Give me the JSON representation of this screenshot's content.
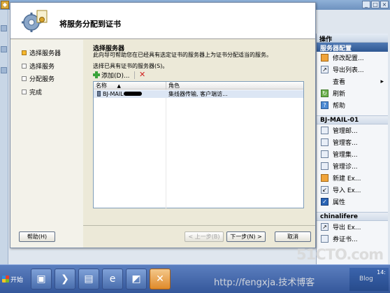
{
  "wizard": {
    "title": "将服务分配到证书",
    "steps": [
      {
        "label": "选择服务器",
        "active": true
      },
      {
        "label": "选择服务",
        "active": false
      },
      {
        "label": "分配服务",
        "active": false
      },
      {
        "label": "完成",
        "active": false
      }
    ],
    "content": {
      "heading": "选择服务器",
      "description": "此向导可帮助您在已经具有选定证书的服务器上为证书分配适当的服务。",
      "list_label": "选择已具有证书的服务器(S)。",
      "add_label": "添加(D)...",
      "columns": [
        "名称",
        "角色"
      ],
      "rows": [
        {
          "name": "BJ-MAIL-",
          "role": "集线器传输, 客户端访..."
        }
      ]
    },
    "buttons": {
      "help": "帮助(H)",
      "back": "< 上一步(B)",
      "next": "下一步(N) >",
      "cancel": "取消"
    }
  },
  "actions_pane": {
    "header": "操作",
    "section1": "服务器配置",
    "section1_items": [
      {
        "label": "修改配置...",
        "icon": "edit-icon"
      },
      {
        "label": "导出列表...",
        "icon": "export-icon"
      },
      {
        "label": "查看",
        "icon": "view-icon"
      },
      {
        "label": "刷新",
        "icon": "refresh-icon"
      },
      {
        "label": "帮助",
        "icon": "help-icon"
      }
    ],
    "section2": "BJ-MAIL-01",
    "section2_items": [
      {
        "label": "管理邮...",
        "icon": "manage-icon"
      },
      {
        "label": "管理客...",
        "icon": "manage-icon"
      },
      {
        "label": "管理集...",
        "icon": "manage-icon"
      },
      {
        "label": "管理诊...",
        "icon": "manage-icon"
      },
      {
        "label": "新建 Ex...",
        "icon": "new-icon"
      },
      {
        "label": "导入 Ex...",
        "icon": "import-icon"
      },
      {
        "label": "属性",
        "icon": "properties-icon"
      }
    ],
    "section3": "chinalifere",
    "section3_items": [
      {
        "label": "导出 Ex...",
        "icon": "export-icon"
      },
      {
        "label": "券证书...",
        "icon": "cert-icon"
      }
    ]
  },
  "taskbar": {
    "start_label": "开始",
    "clock": "14:"
  },
  "watermarks": {
    "site": "51CTO.com",
    "url": "http://fengxja.技术博客",
    "blog": "Blog"
  },
  "colors": {
    "accent": "#2e5792",
    "active_step": "#f5b82e",
    "list_selection": "#dce6f4"
  }
}
